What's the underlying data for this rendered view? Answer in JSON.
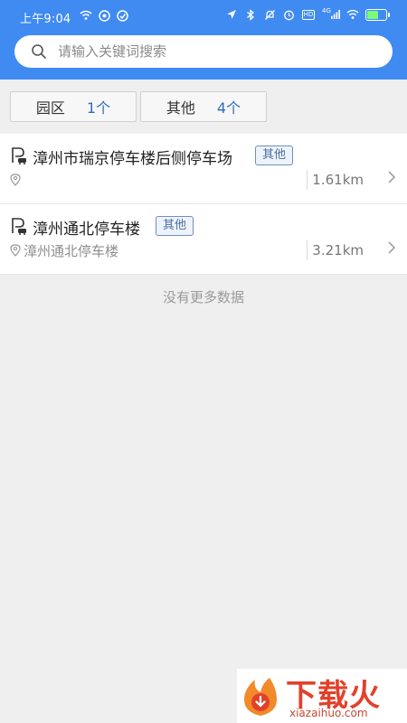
{
  "status_bar": {
    "time": "上午9:04",
    "network_label": "4G",
    "hd_label": "HD"
  },
  "search": {
    "placeholder": "请输入关键词搜索"
  },
  "filters": [
    {
      "label": "园区",
      "count": "1个"
    },
    {
      "label": "其他",
      "count": "4个"
    }
  ],
  "items": [
    {
      "title": "漳州市瑞京停车楼后侧停车场",
      "tag": "其他",
      "address": "",
      "distance": "1.61km"
    },
    {
      "title": "漳州通北停车楼",
      "tag": "其他",
      "address": "漳州通北停车楼",
      "distance": "3.21km"
    }
  ],
  "footer": {
    "no_more": "没有更多数据"
  },
  "watermark": {
    "text": "下载火",
    "sub": "xiazaihuo.com"
  },
  "colors": {
    "header": "#3f8bf2",
    "accent_count": "#2f6db8",
    "tag_border": "#6e8fbd",
    "watermark": "#e2412b"
  }
}
